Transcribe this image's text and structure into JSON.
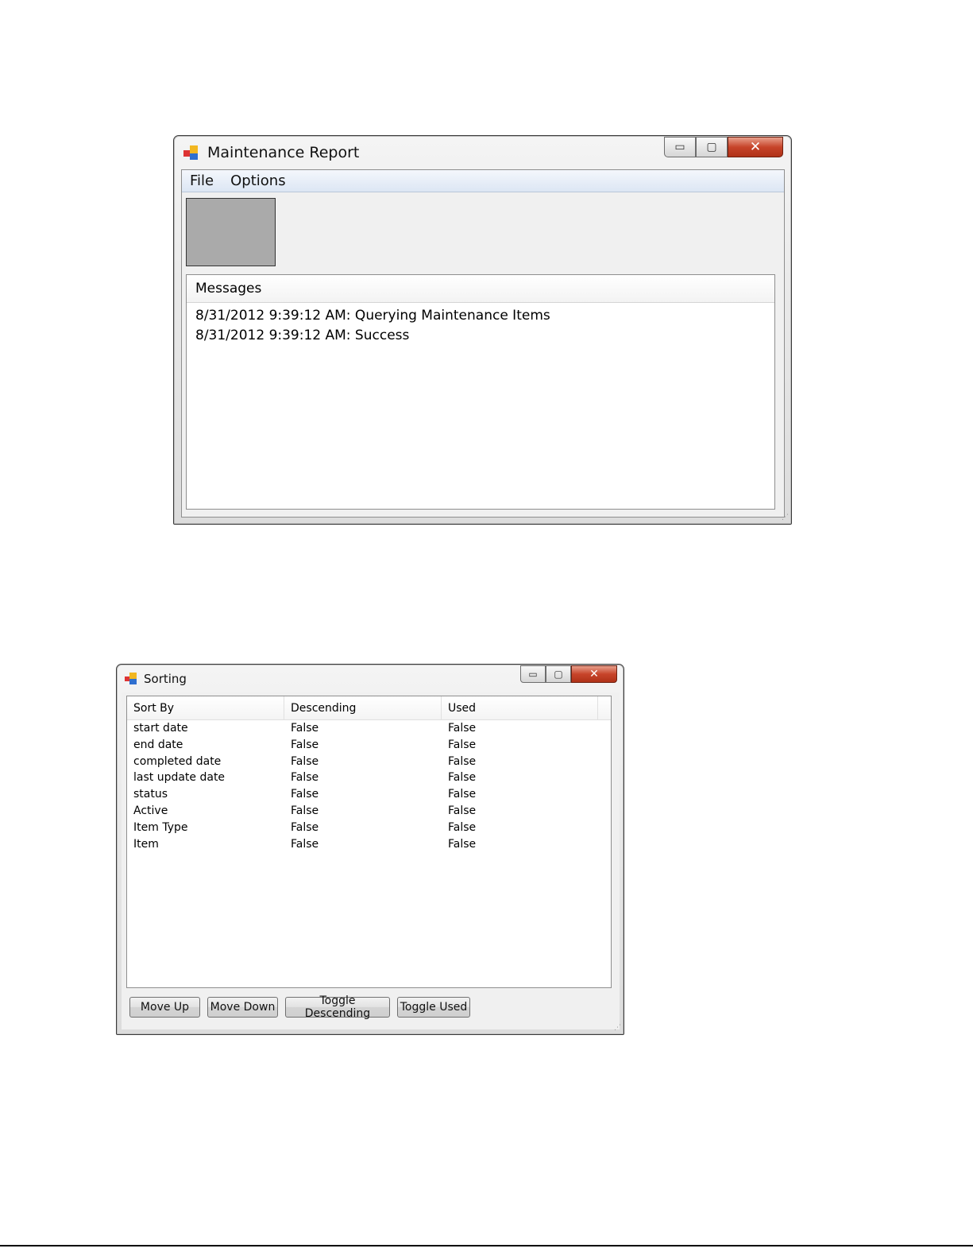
{
  "maintenance_window": {
    "title": "Maintenance Report",
    "controls": {
      "minimize": "▭",
      "maximize": "▢",
      "close": "✕"
    },
    "menu": [
      "File",
      "Options"
    ],
    "messages": {
      "header": "Messages",
      "lines": [
        "8/31/2012 9:39:12 AM: Querying Maintenance Items",
        "8/31/2012 9:39:12 AM: Success"
      ]
    }
  },
  "sorting_window": {
    "title": "Sorting",
    "controls": {
      "minimize": "▭",
      "maximize": "▢",
      "close": "✕"
    },
    "columns": [
      "Sort By",
      "Descending",
      "Used"
    ],
    "rows": [
      [
        "start date",
        "False",
        "False"
      ],
      [
        "end date",
        "False",
        "False"
      ],
      [
        "completed date",
        "False",
        "False"
      ],
      [
        "last update date",
        "False",
        "False"
      ],
      [
        "status",
        "False",
        "False"
      ],
      [
        "Active",
        "False",
        "False"
      ],
      [
        "Item Type",
        "False",
        "False"
      ],
      [
        "Item",
        "False",
        "False"
      ]
    ],
    "buttons": [
      "Move Up",
      "Move Down",
      "Toggle Descending",
      "Toggle Used"
    ]
  }
}
